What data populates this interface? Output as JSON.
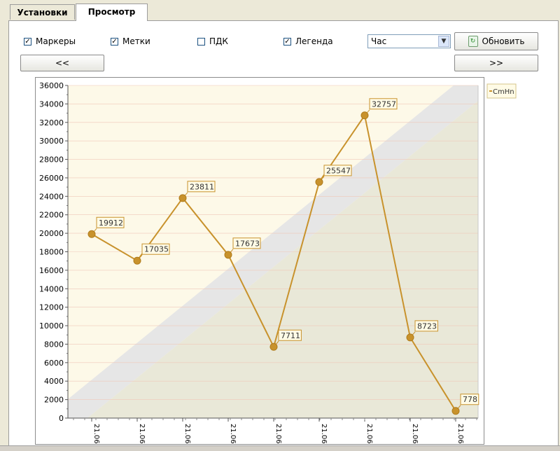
{
  "tabs": [
    {
      "label": "Установки"
    },
    {
      "label": "Просмотр"
    }
  ],
  "controls": {
    "markers": {
      "label": "Маркеры",
      "checked": true
    },
    "labels": {
      "label": "Метки",
      "checked": true
    },
    "pdk": {
      "label": "ПДК",
      "checked": false
    },
    "legend": {
      "label": "Легенда",
      "checked": true
    },
    "period": {
      "selected": "Час"
    },
    "refresh_label": "Обновить",
    "prev_label": "<<",
    "next_label": ">>"
  },
  "colors": {
    "series": "#c8922c",
    "plot_bg": "#fdf9e8",
    "band": "#e6e6e6",
    "lower": "#e9e8d8"
  },
  "chart_data": {
    "type": "line",
    "categories": [
      "21.06",
      "21.06",
      "21.06",
      "21.06",
      "21.06",
      "21.06",
      "21.06",
      "21.06",
      "21.06"
    ],
    "series": [
      {
        "name": "CmHn",
        "values": [
          19912,
          17035,
          23811,
          17673,
          7711,
          25547,
          32757,
          8723,
          778
        ]
      }
    ],
    "ylim": [
      0,
      36000
    ],
    "yticks": [
      "0",
      "2000",
      "4000",
      "6000",
      "8000",
      "10000",
      "12000",
      "14000",
      "16000",
      "18000",
      "20000",
      "22000",
      "24000",
      "26000",
      "28000",
      "30000",
      "32000",
      "34000",
      "36000"
    ],
    "grid": true,
    "legend_position": "top-right",
    "data_labels": true,
    "markers": true
  }
}
